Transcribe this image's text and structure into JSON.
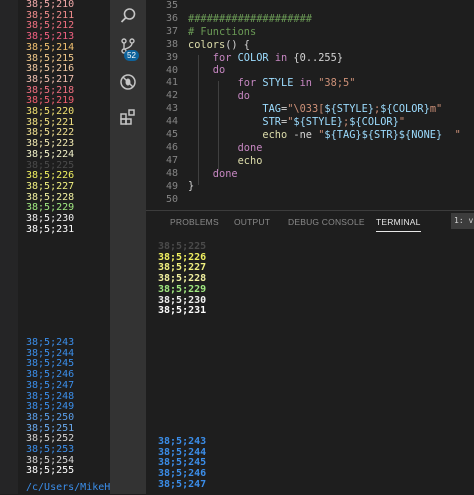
{
  "left_terminal": {
    "lines": [
      {
        "text": "38;5;210",
        "color": "#f0a9a9"
      },
      {
        "text": "38;5;211",
        "color": "#f08c8c"
      },
      {
        "text": "38;5;212",
        "color": "#f07080"
      },
      {
        "text": "38;5;213",
        "color": "#f06080"
      },
      {
        "text": "38;5;214",
        "color": "#f0c070"
      },
      {
        "text": "38;5;215",
        "color": "#f0c88a"
      },
      {
        "text": "38;5;216",
        "color": "#f0c8a0"
      },
      {
        "text": "38;5;217",
        "color": "#f0c0b0"
      },
      {
        "text": "38;5;218",
        "color": "#f07080"
      },
      {
        "text": "38;5;219",
        "color": "#f06070"
      },
      {
        "text": "38;5;220",
        "color": "#f0e070"
      },
      {
        "text": "38;5;221",
        "color": "#f0e080"
      },
      {
        "text": "38;5;222",
        "color": "#f0e090"
      },
      {
        "text": "38;5;223",
        "color": "#f0e8b0"
      },
      {
        "text": "38;5;224",
        "color": "#f0f0c8"
      },
      {
        "text": "38;5;225",
        "color": "#4a4a4a"
      },
      {
        "text": "38;5;226",
        "color": "#f0f060"
      },
      {
        "text": "38;5;227",
        "color": "#f0f080"
      },
      {
        "text": "38;5;228",
        "color": "#f0f0a0"
      },
      {
        "text": "38;5;229",
        "color": "#a0e880"
      },
      {
        "text": "38;5;230",
        "color": "#f0f0f0"
      },
      {
        "text": "38;5;231",
        "color": "#ffffff"
      }
    ],
    "lines_bottom": [
      {
        "text": "38;5;243",
        "color": "#3b8eea"
      },
      {
        "text": "38;5;244",
        "color": "#3b8eea"
      },
      {
        "text": "38;5;245",
        "color": "#3b8eea"
      },
      {
        "text": "38;5;246",
        "color": "#3b8eea"
      },
      {
        "text": "38;5;247",
        "color": "#3b8eea"
      },
      {
        "text": "38;5;248",
        "color": "#3b8eea"
      },
      {
        "text": "38;5;249",
        "color": "#3b8eea"
      },
      {
        "text": "38;5;250",
        "color": "#5a9eea"
      },
      {
        "text": "38;5;251",
        "color": "#6aaaee"
      },
      {
        "text": "38;5;252",
        "color": "#d4d4d4"
      },
      {
        "text": "38;5;253",
        "color": "#3b8eea"
      },
      {
        "text": "38;5;254",
        "color": "#d4d4d4"
      },
      {
        "text": "38;5;255",
        "color": "#ffffff"
      }
    ],
    "path": "/c/Users/MikeHam"
  },
  "activity_bar": {
    "icons": [
      "search-icon",
      "source-control-icon",
      "debug-icon",
      "extensions-icon"
    ],
    "source_control_badge": "52"
  },
  "editor": {
    "line_numbers": [
      "35",
      "36",
      "37",
      "38",
      "39",
      "40",
      "41",
      "42",
      "43",
      "44",
      "45",
      "46",
      "47",
      "48",
      "49",
      "50"
    ],
    "code_lines": [
      [],
      [
        {
          "t": "####################",
          "c": "#6a9955"
        }
      ],
      [
        {
          "t": "# Functions",
          "c": "#6a9955"
        }
      ],
      [
        {
          "t": "colors",
          "c": "#dcdcaa"
        },
        {
          "t": "() {",
          "c": "#d4d4d4"
        }
      ],
      [
        {
          "t": "    for ",
          "c": "#c586c0"
        },
        {
          "t": "COLOR ",
          "c": "#9cdcfe"
        },
        {
          "t": "in ",
          "c": "#c586c0"
        },
        {
          "t": "{0..255}",
          "c": "#d4d4d4"
        }
      ],
      [
        {
          "t": "    do",
          "c": "#c586c0"
        }
      ],
      [
        {
          "t": "        for ",
          "c": "#c586c0"
        },
        {
          "t": "STYLE ",
          "c": "#9cdcfe"
        },
        {
          "t": "in ",
          "c": "#c586c0"
        },
        {
          "t": "\"38;5\"",
          "c": "#ce9178"
        }
      ],
      [
        {
          "t": "        do",
          "c": "#c586c0"
        }
      ],
      [
        {
          "t": "            TAG",
          "c": "#9cdcfe"
        },
        {
          "t": "=",
          "c": "#d4d4d4"
        },
        {
          "t": "\"\\033[",
          "c": "#ce9178"
        },
        {
          "t": "${STYLE}",
          "c": "#9cdcfe"
        },
        {
          "t": ";",
          "c": "#ce9178"
        },
        {
          "t": "${COLOR}",
          "c": "#9cdcfe"
        },
        {
          "t": "m\"",
          "c": "#ce9178"
        }
      ],
      [
        {
          "t": "            STR",
          "c": "#9cdcfe"
        },
        {
          "t": "=",
          "c": "#d4d4d4"
        },
        {
          "t": "\"",
          "c": "#ce9178"
        },
        {
          "t": "${STYLE}",
          "c": "#9cdcfe"
        },
        {
          "t": ";",
          "c": "#ce9178"
        },
        {
          "t": "${COLOR}",
          "c": "#9cdcfe"
        },
        {
          "t": "\"",
          "c": "#ce9178"
        }
      ],
      [
        {
          "t": "            echo ",
          "c": "#dcdcaa"
        },
        {
          "t": "-ne ",
          "c": "#d4d4d4"
        },
        {
          "t": "\"",
          "c": "#ce9178"
        },
        {
          "t": "${TAG}${STR}${NONE}",
          "c": "#9cdcfe"
        },
        {
          "t": "  \"",
          "c": "#ce9178"
        }
      ],
      [
        {
          "t": "        done",
          "c": "#c586c0"
        }
      ],
      [
        {
          "t": "        echo",
          "c": "#dcdcaa"
        }
      ],
      [
        {
          "t": "    done",
          "c": "#c586c0"
        }
      ],
      [
        {
          "t": "}",
          "c": "#d4d4d4"
        }
      ],
      []
    ]
  },
  "panel": {
    "tabs": [
      {
        "label": "PROBLEMS",
        "active": false
      },
      {
        "label": "OUTPUT",
        "active": false
      },
      {
        "label": "DEBUG CONSOLE",
        "active": false
      },
      {
        "label": "TERMINAL",
        "active": true
      }
    ],
    "terminal_select": "1: v",
    "terminal_top": [
      {
        "text": "38;5;225",
        "color": "#4a4a4a"
      },
      {
        "text": "38;5;226",
        "color": "#f0f060"
      },
      {
        "text": "38;5;227",
        "color": "#f0f080"
      },
      {
        "text": "38;5;228",
        "color": "#f0f0a0"
      },
      {
        "text": "38;5;229",
        "color": "#a0e880"
      },
      {
        "text": "38;5;230",
        "color": "#f0f0f0"
      },
      {
        "text": "38;5;231",
        "color": "#ffffff"
      }
    ],
    "terminal_bottom": [
      {
        "text": "38;5;243",
        "color": "#3b8eea"
      },
      {
        "text": "38;5;244",
        "color": "#3b8eea"
      },
      {
        "text": "38;5;245",
        "color": "#3b8eea"
      },
      {
        "text": "38;5;246",
        "color": "#3b8eea"
      },
      {
        "text": "38;5;247",
        "color": "#3b8eea"
      }
    ]
  }
}
